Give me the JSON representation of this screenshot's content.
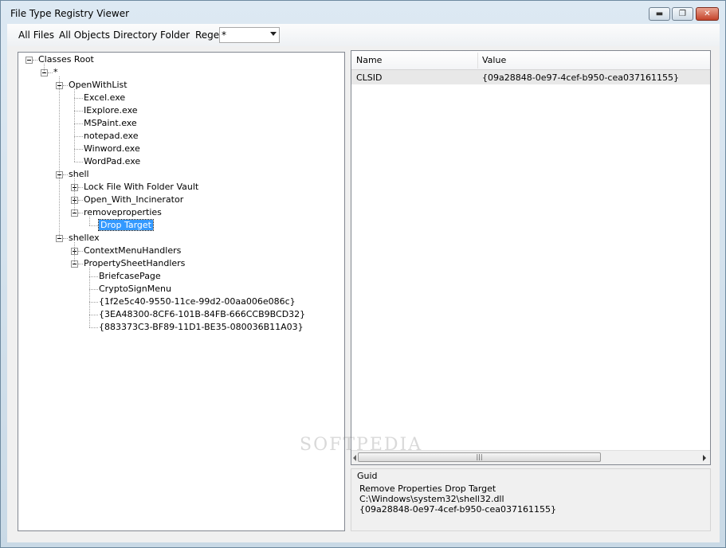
{
  "window": {
    "title": "File Type Registry Viewer",
    "controls": {
      "minimize": "▬",
      "maximize": "❐",
      "close": "✕"
    }
  },
  "menu": {
    "all_files": "All Files",
    "all_objects": "All Objects",
    "directory": "Directory",
    "folder": "Folder",
    "regex_label": "Regex",
    "regex_value": "*"
  },
  "tree": {
    "nodes": [
      {
        "label": "Classes Root",
        "expander": "minus"
      },
      {
        "label": "*",
        "expander": "minus"
      },
      {
        "label": "OpenWithList",
        "expander": "minus"
      },
      {
        "label": "Excel.exe"
      },
      {
        "label": "IExplore.exe"
      },
      {
        "label": "MSPaint.exe"
      },
      {
        "label": "notepad.exe"
      },
      {
        "label": "Winword.exe"
      },
      {
        "label": "WordPad.exe"
      },
      {
        "label": "shell",
        "expander": "minus"
      },
      {
        "label": "Lock File With Folder Vault",
        "expander": "plus"
      },
      {
        "label": "Open_With_Incinerator",
        "expander": "plus"
      },
      {
        "label": "removeproperties",
        "expander": "minus"
      },
      {
        "label": "Drop Target",
        "selected": true
      },
      {
        "label": "shellex",
        "expander": "minus"
      },
      {
        "label": "ContextMenuHandlers",
        "expander": "plus"
      },
      {
        "label": "PropertySheetHandlers",
        "expander": "minus"
      },
      {
        "label": "BriefcasePage"
      },
      {
        "label": "CryptoSignMenu"
      },
      {
        "label": "{1f2e5c40-9550-11ce-99d2-00aa006e086c}"
      },
      {
        "label": "{3EA48300-8CF6-101B-84FB-666CCB9BCD32}"
      },
      {
        "label": "{883373C3-BF89-11D1-BE35-080036B11A03}"
      }
    ]
  },
  "list": {
    "columns": [
      "Name",
      "Value"
    ],
    "rows": [
      {
        "name": "CLSID",
        "value": "{09a28848-0e97-4cef-b950-cea037161155}"
      }
    ],
    "scroll_grip": "|||"
  },
  "info": {
    "group_label": "Guid",
    "lines": [
      "Remove Properties Drop Target",
      "C:\\Windows\\system32\\shell32.dll",
      "{09a28848-0e97-4cef-b950-cea037161155}"
    ]
  },
  "watermark": "SOFTPEDIA"
}
